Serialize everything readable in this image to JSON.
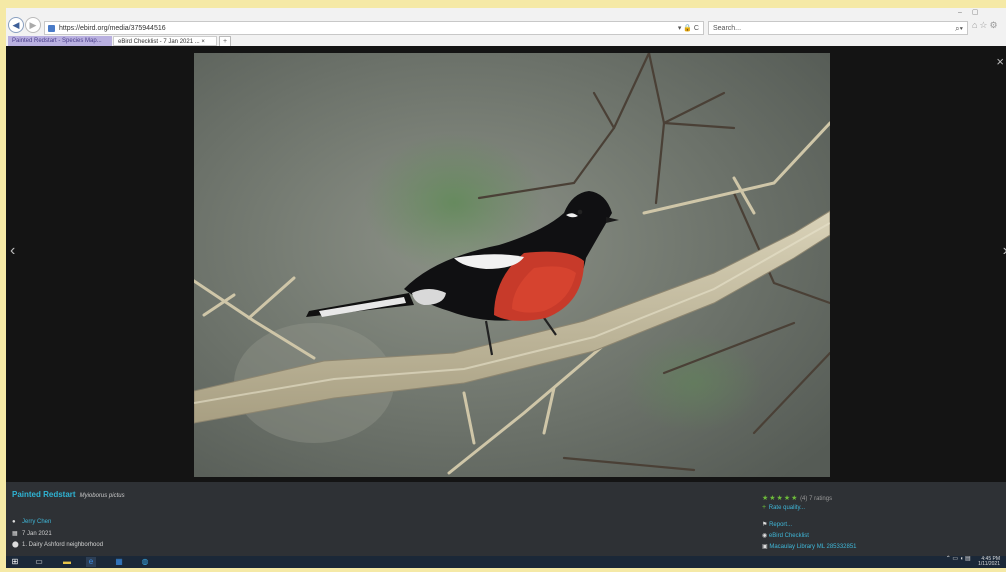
{
  "browser": {
    "url": "https://ebird.org/media/375944516",
    "address_icons": "▾ 🔒 C",
    "search_placeholder": "Search...",
    "tabs": [
      {
        "label": "Painted Redstart - Species Map..."
      },
      {
        "label": "eBird Checklist - 7 Jan 2021 ... ×"
      }
    ]
  },
  "lightbox": {
    "prev_glyph": "‹",
    "next_glyph": "›",
    "close_glyph": "×",
    "photo_subject": "Painted Redstart"
  },
  "info": {
    "common_name": "Painted Redstart",
    "scientific_name": "Myioborus pictus",
    "observer": "Jerry Chen",
    "date": "7 Jan 2021",
    "location": "1. Dairy Ashford neighborhood",
    "rating_stars": "★★★★★",
    "rating_count": "(4) 7 ratings",
    "rate_quality": "Rate quality...",
    "report": "Report...",
    "checklist": "eBird Checklist",
    "catalog": "Macaulay Library ML 285332851"
  },
  "taskbar": {
    "time": "4:45 PM",
    "date": "1/11/2021"
  },
  "colors": {
    "accent": "#2fb4d4",
    "panel": "#2e3135",
    "stars": "#6dbb3a"
  }
}
